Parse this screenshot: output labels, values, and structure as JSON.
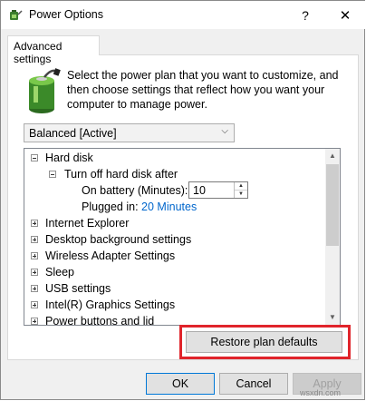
{
  "window": {
    "title": "Power Options",
    "help_glyph": "?",
    "close_glyph": "✕"
  },
  "tab": {
    "label": "Advanced settings"
  },
  "intro": {
    "text": "Select the power plan that you want to customize, and then choose settings that reflect how you want your computer to manage power."
  },
  "plan_select": {
    "value": "Balanced [Active]"
  },
  "tree": {
    "hard_disk": "Hard disk",
    "turn_off": "Turn off hard disk after",
    "on_battery_label": "On battery (Minutes):",
    "on_battery_value": "10",
    "plugged_label": "Plugged in:",
    "plugged_value": "20 Minutes",
    "items": [
      "Internet Explorer",
      "Desktop background settings",
      "Wireless Adapter Settings",
      "Sleep",
      "USB settings",
      "Intel(R) Graphics Settings",
      "Power buttons and lid"
    ]
  },
  "buttons": {
    "restore": "Restore plan defaults",
    "ok": "OK",
    "cancel": "Cancel",
    "apply": "Apply"
  },
  "watermark": "wsxdn.com",
  "colors": {
    "highlight_box": "#e0242b",
    "link_blue": "#0066cc"
  }
}
